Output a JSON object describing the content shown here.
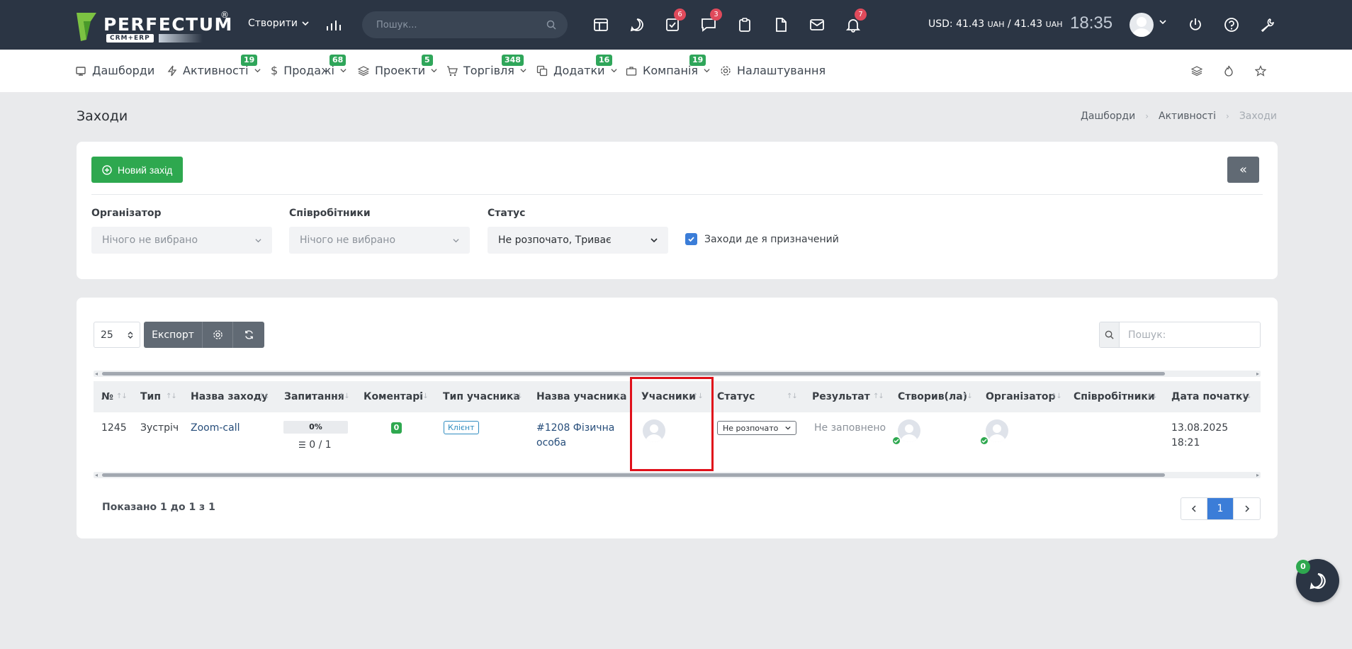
{
  "colors": {
    "topbar": "#2b3544",
    "accent_green": "#2ea84f",
    "accent_blue": "#3b7dd8",
    "badge_red": "#e04a5b",
    "highlight": "#e0101a"
  },
  "topbar": {
    "logo_text": "PERFECTUM",
    "logo_reg": "®",
    "logo_sub": "CRM+ERP",
    "create_label": "Створити",
    "search_placeholder": "Пошук...",
    "icons": [
      {
        "name": "layout-icon",
        "badge": ""
      },
      {
        "name": "chat-icon",
        "badge": ""
      },
      {
        "name": "task-check-icon",
        "badge": "6"
      },
      {
        "name": "messages-icon",
        "badge": "3"
      },
      {
        "name": "clipboard-icon",
        "badge": ""
      },
      {
        "name": "document-icon",
        "badge": ""
      },
      {
        "name": "mail-icon",
        "badge": ""
      },
      {
        "name": "bell-icon",
        "badge": "7"
      }
    ],
    "currency": "USD: 41.43",
    "currency_unit": "UAH",
    "currency_sep": " / ",
    "currency_value2": "41.43",
    "time": "18:35"
  },
  "nav": {
    "items": [
      {
        "label": "Дашборди",
        "badge": ""
      },
      {
        "label": "Активності",
        "badge": "19"
      },
      {
        "label": "Продажі",
        "badge": "68"
      },
      {
        "label": "Проекти",
        "badge": "5"
      },
      {
        "label": "Торгівля",
        "badge": "348"
      },
      {
        "label": "Додатки",
        "badge": "16"
      },
      {
        "label": "Компанія",
        "badge": "19"
      },
      {
        "label": "Налаштування",
        "badge": ""
      }
    ]
  },
  "page": {
    "title": "Заходи",
    "breadcrumb": [
      "Дашборди",
      "Активності",
      "Заходи"
    ]
  },
  "filters": {
    "new_button": "Новий захід",
    "collapse": "«",
    "organizer_label": "Організатор",
    "organizer_value": "Нічого не вибрано",
    "employees_label": "Співробітники",
    "employees_value": "Нічого не вибрано",
    "status_label": "Статус",
    "status_value": "Не розпочато, Триває",
    "assigned_label": "Заходи де я призначений",
    "assigned_checked": true
  },
  "table": {
    "page_size": "25",
    "export_label": "Експорт",
    "search_placeholder": "Пошук:",
    "columns": [
      "№",
      "Тип",
      "Назва заходу",
      "Запитання",
      "Коментарі",
      "Тип учасника",
      "Назва учасника",
      "Учасники",
      "Статус",
      "Результат",
      "Створив(ла)",
      "Організатор",
      "Співробітники",
      "Дата початку"
    ],
    "rows": [
      {
        "id": "1245",
        "type": "Зустріч",
        "name": "Zoom-call",
        "questions_percent": "0%",
        "questions_fraction": "0 / 1",
        "comments": "0",
        "participant_type": "Клієнт",
        "participant_name_1": "#1208 Фізична",
        "participant_name_2": "особа",
        "status": "Не розпочато",
        "result": "Не заповнено",
        "date_1": "13.08.2025",
        "date_2": "18:21"
      }
    ],
    "summary": "Показано 1 до 1 з 1",
    "current_page": "1"
  },
  "chat": {
    "badge": "0"
  }
}
